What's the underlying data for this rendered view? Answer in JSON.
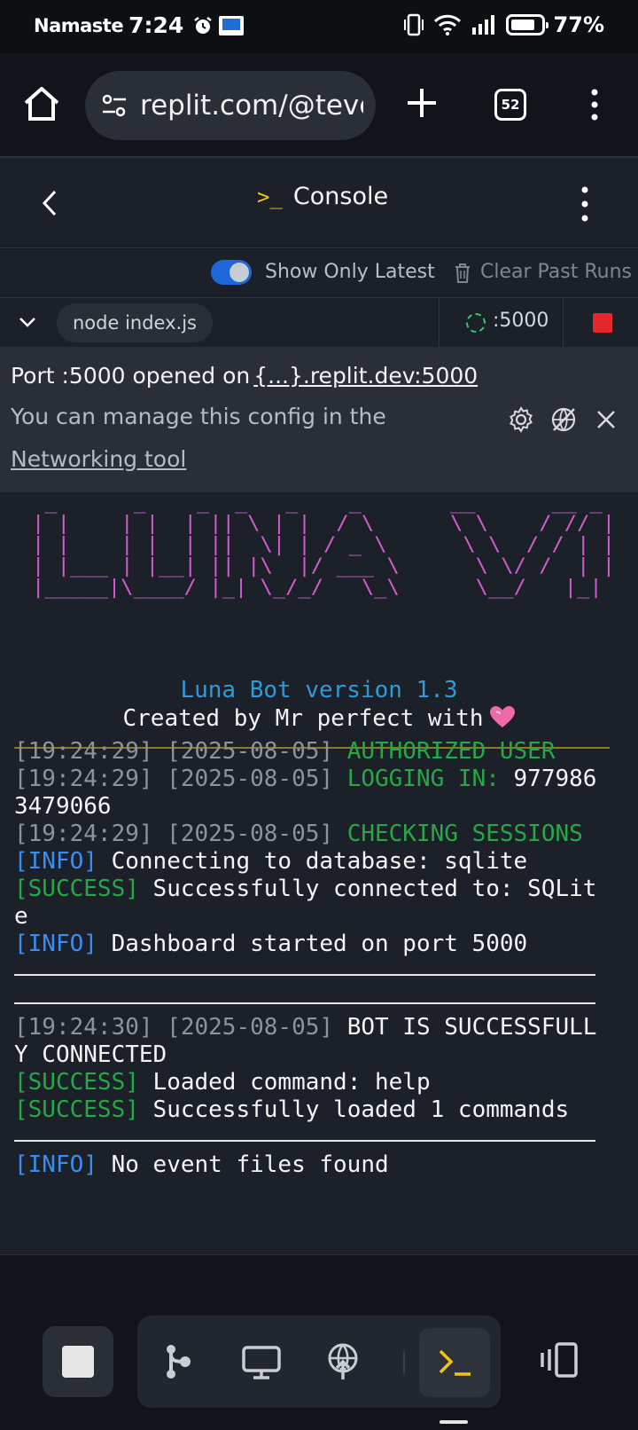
{
  "status_bar": {
    "carrier": "Namaste",
    "time": "7:24",
    "battery_pct": "77%"
  },
  "browser": {
    "url": "replit.com/@teve",
    "tab_count": "52"
  },
  "console_header": {
    "prompt_icon": ">_",
    "title": "Console"
  },
  "toolbar": {
    "show_only_latest": "Show Only Latest",
    "show_only_latest_on": true,
    "clear_past_runs": "Clear Past Runs"
  },
  "run": {
    "command": "node index.js",
    "port": ":5000"
  },
  "notice": {
    "line1_prefix": "Port :5000 opened on",
    "line1_link": "{...}.replit.dev:5000",
    "line2": "You can manage this config in the",
    "line3_link": "Networking tool"
  },
  "output": {
    "ascii_art": " _      _    _  _   _    _       __      __ _ \n| |    | |  | || \\ | |  / \\      \\ \\    / // |\n| |    | |  | ||  \\| | / _ \\      \\ \\  / / | |\n| |___ | |__| || |\\  |/ ___ \\      \\ \\/ /  | |\n|_____|\\____/ |_| \\_/_/   \\_\\      \\__/   |_|",
    "version_line": "Luna Bot version 1.3",
    "created_line": "Created by Mr perfect with",
    "logs": [
      {
        "ts": "[19:24:29] [2025-08-05] ",
        "msg": "AUTHORIZED USER"
      },
      {
        "ts": "[19:24:29] [2025-08-05] ",
        "msg": "LOGGING IN: ",
        "extra": "977986",
        "cont": "3479066"
      },
      {
        "ts": "[19:24:29] [2025-08-05] ",
        "msg": "CHECKING SESSIONS"
      },
      {
        "tag": "[INFO]",
        "msg": " Connecting to database: sqlite"
      },
      {
        "tag": "[SUCCESS]",
        "msg": " Successfully connected to: SQLit",
        "cont": "e"
      },
      {
        "tag": "[INFO]",
        "msg": " Dashboard started on port 5000"
      },
      {
        "ts": "[19:24:30] [2025-08-05] ",
        "msg": "BOT IS SUCCESSFULL",
        "cont": "Y CONNECTED"
      },
      {
        "tag": "[SUCCESS]",
        "msg": " Loaded command: help"
      },
      {
        "tag": "[SUCCESS]",
        "msg": " Successfully loaded 1 commands"
      },
      {
        "tag": "[INFO]",
        "msg": " No event files found"
      }
    ]
  },
  "colors": {
    "accent_blue": "#1e67d6",
    "success_green": "#25a845",
    "info_blue": "#3b8df0",
    "ascii_magenta": "#d25bd1",
    "stop_red": "#e4282b"
  },
  "icons": [
    "home-icon",
    "tune-icon",
    "plus-icon",
    "tabs-icon",
    "menu-icon",
    "back-icon",
    "kebab-icon",
    "trash-icon",
    "chevron-down-icon",
    "gear-icon",
    "eye-off-icon",
    "close-icon",
    "heart-icon",
    "stop-icon",
    "git-icon",
    "monitor-icon",
    "deploy-icon",
    "terminal-icon",
    "devices-icon"
  ]
}
